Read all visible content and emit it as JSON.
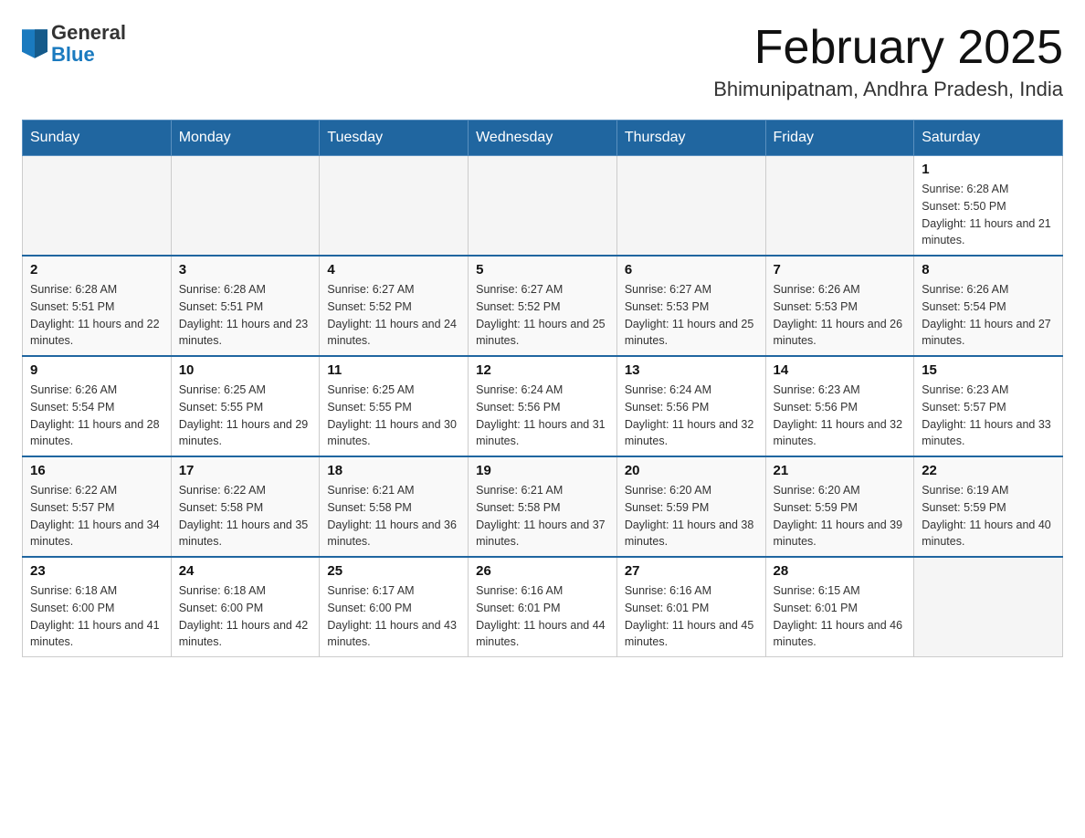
{
  "header": {
    "logo": {
      "general": "General",
      "blue": "Blue",
      "alt": "GeneralBlue logo"
    },
    "title": "February 2025",
    "location": "Bhimunipatnam, Andhra Pradesh, India"
  },
  "calendar": {
    "days_of_week": [
      "Sunday",
      "Monday",
      "Tuesday",
      "Wednesday",
      "Thursday",
      "Friday",
      "Saturday"
    ],
    "weeks": [
      [
        {
          "day": "",
          "info": ""
        },
        {
          "day": "",
          "info": ""
        },
        {
          "day": "",
          "info": ""
        },
        {
          "day": "",
          "info": ""
        },
        {
          "day": "",
          "info": ""
        },
        {
          "day": "",
          "info": ""
        },
        {
          "day": "1",
          "info": "Sunrise: 6:28 AM\nSunset: 5:50 PM\nDaylight: 11 hours and 21 minutes."
        }
      ],
      [
        {
          "day": "2",
          "info": "Sunrise: 6:28 AM\nSunset: 5:51 PM\nDaylight: 11 hours and 22 minutes."
        },
        {
          "day": "3",
          "info": "Sunrise: 6:28 AM\nSunset: 5:51 PM\nDaylight: 11 hours and 23 minutes."
        },
        {
          "day": "4",
          "info": "Sunrise: 6:27 AM\nSunset: 5:52 PM\nDaylight: 11 hours and 24 minutes."
        },
        {
          "day": "5",
          "info": "Sunrise: 6:27 AM\nSunset: 5:52 PM\nDaylight: 11 hours and 25 minutes."
        },
        {
          "day": "6",
          "info": "Sunrise: 6:27 AM\nSunset: 5:53 PM\nDaylight: 11 hours and 25 minutes."
        },
        {
          "day": "7",
          "info": "Sunrise: 6:26 AM\nSunset: 5:53 PM\nDaylight: 11 hours and 26 minutes."
        },
        {
          "day": "8",
          "info": "Sunrise: 6:26 AM\nSunset: 5:54 PM\nDaylight: 11 hours and 27 minutes."
        }
      ],
      [
        {
          "day": "9",
          "info": "Sunrise: 6:26 AM\nSunset: 5:54 PM\nDaylight: 11 hours and 28 minutes."
        },
        {
          "day": "10",
          "info": "Sunrise: 6:25 AM\nSunset: 5:55 PM\nDaylight: 11 hours and 29 minutes."
        },
        {
          "day": "11",
          "info": "Sunrise: 6:25 AM\nSunset: 5:55 PM\nDaylight: 11 hours and 30 minutes."
        },
        {
          "day": "12",
          "info": "Sunrise: 6:24 AM\nSunset: 5:56 PM\nDaylight: 11 hours and 31 minutes."
        },
        {
          "day": "13",
          "info": "Sunrise: 6:24 AM\nSunset: 5:56 PM\nDaylight: 11 hours and 32 minutes."
        },
        {
          "day": "14",
          "info": "Sunrise: 6:23 AM\nSunset: 5:56 PM\nDaylight: 11 hours and 32 minutes."
        },
        {
          "day": "15",
          "info": "Sunrise: 6:23 AM\nSunset: 5:57 PM\nDaylight: 11 hours and 33 minutes."
        }
      ],
      [
        {
          "day": "16",
          "info": "Sunrise: 6:22 AM\nSunset: 5:57 PM\nDaylight: 11 hours and 34 minutes."
        },
        {
          "day": "17",
          "info": "Sunrise: 6:22 AM\nSunset: 5:58 PM\nDaylight: 11 hours and 35 minutes."
        },
        {
          "day": "18",
          "info": "Sunrise: 6:21 AM\nSunset: 5:58 PM\nDaylight: 11 hours and 36 minutes."
        },
        {
          "day": "19",
          "info": "Sunrise: 6:21 AM\nSunset: 5:58 PM\nDaylight: 11 hours and 37 minutes."
        },
        {
          "day": "20",
          "info": "Sunrise: 6:20 AM\nSunset: 5:59 PM\nDaylight: 11 hours and 38 minutes."
        },
        {
          "day": "21",
          "info": "Sunrise: 6:20 AM\nSunset: 5:59 PM\nDaylight: 11 hours and 39 minutes."
        },
        {
          "day": "22",
          "info": "Sunrise: 6:19 AM\nSunset: 5:59 PM\nDaylight: 11 hours and 40 minutes."
        }
      ],
      [
        {
          "day": "23",
          "info": "Sunrise: 6:18 AM\nSunset: 6:00 PM\nDaylight: 11 hours and 41 minutes."
        },
        {
          "day": "24",
          "info": "Sunrise: 6:18 AM\nSunset: 6:00 PM\nDaylight: 11 hours and 42 minutes."
        },
        {
          "day": "25",
          "info": "Sunrise: 6:17 AM\nSunset: 6:00 PM\nDaylight: 11 hours and 43 minutes."
        },
        {
          "day": "26",
          "info": "Sunrise: 6:16 AM\nSunset: 6:01 PM\nDaylight: 11 hours and 44 minutes."
        },
        {
          "day": "27",
          "info": "Sunrise: 6:16 AM\nSunset: 6:01 PM\nDaylight: 11 hours and 45 minutes."
        },
        {
          "day": "28",
          "info": "Sunrise: 6:15 AM\nSunset: 6:01 PM\nDaylight: 11 hours and 46 minutes."
        },
        {
          "day": "",
          "info": ""
        }
      ]
    ]
  }
}
